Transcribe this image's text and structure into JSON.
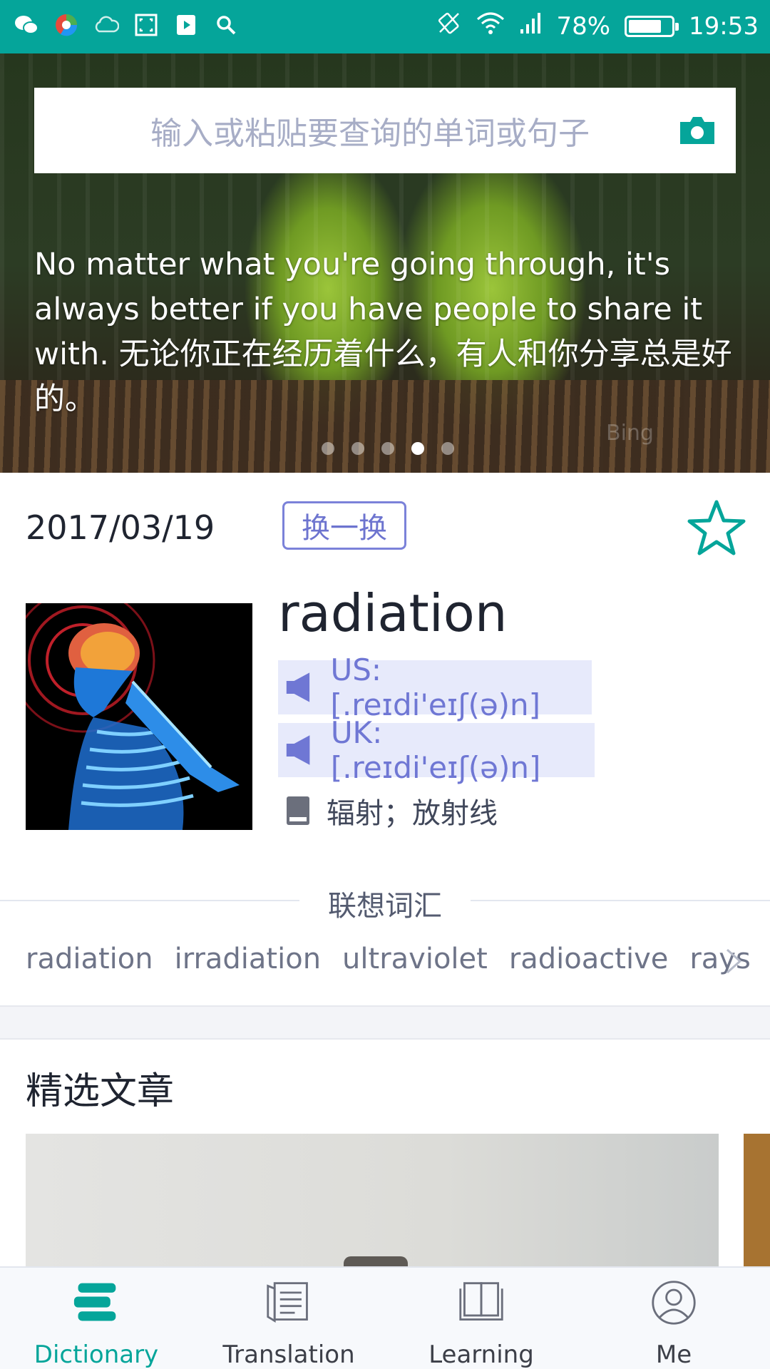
{
  "colors": {
    "accent": "#05a59a",
    "link": "#6f77d4",
    "pron_bg": "#e7eafb"
  },
  "status_bar": {
    "left_icons": [
      "wechat-icon",
      "browser-icon",
      "cloud-icon",
      "screenshot-icon",
      "video-icon",
      "search-icon"
    ],
    "right_icons": [
      "rotate-icon",
      "wifi-icon",
      "signal-icon"
    ],
    "battery": "78%",
    "battery_level": 0.78,
    "time": "19:53"
  },
  "hero": {
    "search_placeholder": "输入或粘贴要查询的单词或句子",
    "quote": "No matter what you're going through, it's always better if you have people to share it with. 无论你正在经历着什么，有人和你分享总是好的。",
    "watermark": "Bing",
    "dots_count": 5,
    "active_dot": 3
  },
  "word_of_day": {
    "date": "2017/03/19",
    "change_label": "换一换",
    "word": "radiation",
    "us_pron": "US: [.reɪdi'eɪʃ(ə)n]",
    "uk_pron": "UK: [.reɪdi'eɪʃ(ə)n]",
    "meaning": "辐射；放射线"
  },
  "related": {
    "title": "联想词汇",
    "words": [
      "radiation",
      "irradiation",
      "ultraviolet",
      "radioactive",
      "rays"
    ]
  },
  "articles": {
    "title": "精选文章"
  },
  "bottom_nav": {
    "items": [
      {
        "label": "Dictionary",
        "icon": "dictionary-icon",
        "active": true
      },
      {
        "label": "Translation",
        "icon": "translation-icon",
        "active": false
      },
      {
        "label": "Learning",
        "icon": "learning-icon",
        "active": false
      },
      {
        "label": "Me",
        "icon": "profile-icon",
        "active": false
      }
    ]
  }
}
